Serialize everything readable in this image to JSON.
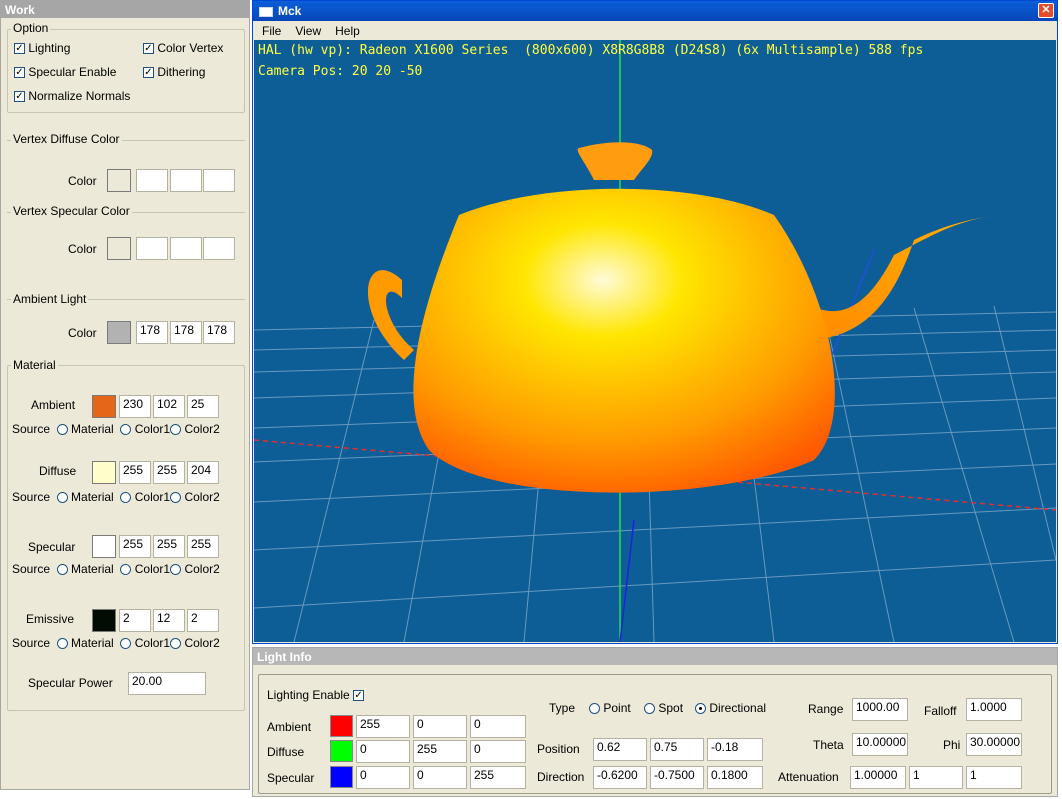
{
  "work": {
    "title": "Work",
    "option": {
      "legend": "Option",
      "lighting": "Lighting",
      "color_vertex": "Color Vertex",
      "specular_enable": "Specular Enable",
      "dithering": "Dithering",
      "normalize_normals": "Normalize Normals"
    },
    "vertex_diffuse": {
      "legend": "Vertex Diffuse Color",
      "label": "Color"
    },
    "vertex_specular": {
      "legend": "Vertex Specular Color",
      "label": "Color"
    },
    "ambient_light": {
      "legend": "Ambient Light",
      "label": "Color",
      "color": "#b2b2b2",
      "r": "178",
      "g": "178",
      "b": "178"
    },
    "material": {
      "legend": "Material",
      "source_label": "Source",
      "opt_material": "Material",
      "opt_color1": "Color1",
      "opt_color2": "Color2",
      "ambient": {
        "label": "Ambient",
        "color": "#e66619",
        "r": "230",
        "g": "102",
        "b": "25"
      },
      "diffuse": {
        "label": "Diffuse",
        "color": "#ffffcc",
        "r": "255",
        "g": "255",
        "b": "204"
      },
      "specular": {
        "label": "Specular",
        "color": "#ffffff",
        "r": "255",
        "g": "255",
        "b": "255"
      },
      "emissive": {
        "label": "Emissive",
        "color": "#020c02",
        "r": "2",
        "g": "12",
        "b": "2"
      },
      "power_label": "Specular Power",
      "power": "20.00"
    }
  },
  "mck": {
    "title": "Mck",
    "menu": [
      "File",
      "View",
      "Help"
    ],
    "hud1": "HAL (hw vp): Radeon X1600 Series  (800x600) X8R8G8B8 (D24S8) (6x Multisample) 588 fps",
    "hud2": "Camera Pos: 20 20 -50"
  },
  "light": {
    "title": "Light Info",
    "enable_label": "Lighting Enable",
    "ambient": {
      "label": "Ambient",
      "color": "#ff0000",
      "r": "255",
      "g": "0",
      "b": "0"
    },
    "diffuse": {
      "label": "Diffuse",
      "color": "#00ff00",
      "r": "0",
      "g": "255",
      "b": "0"
    },
    "specular": {
      "label": "Specular",
      "color": "#0000ff",
      "r": "0",
      "g": "0",
      "b": "255"
    },
    "type_label": "Type",
    "point": "Point",
    "spot": "Spot",
    "directional": "Directional",
    "position_label": "Position",
    "pos": [
      "0.62",
      "0.75",
      "-0.18"
    ],
    "direction_label": "Direction",
    "dir": [
      "-0.6200",
      "-0.7500",
      "0.1800"
    ],
    "range_label": "Range",
    "range": "1000.00",
    "falloff_label": "Falloff",
    "falloff": "1.0000",
    "theta_label": "Theta",
    "theta": "10.00000",
    "phi_label": "Phi",
    "phi": "30.00000",
    "atten_label": "Attenuation",
    "atten": [
      "1.00000",
      "1",
      "1"
    ]
  }
}
